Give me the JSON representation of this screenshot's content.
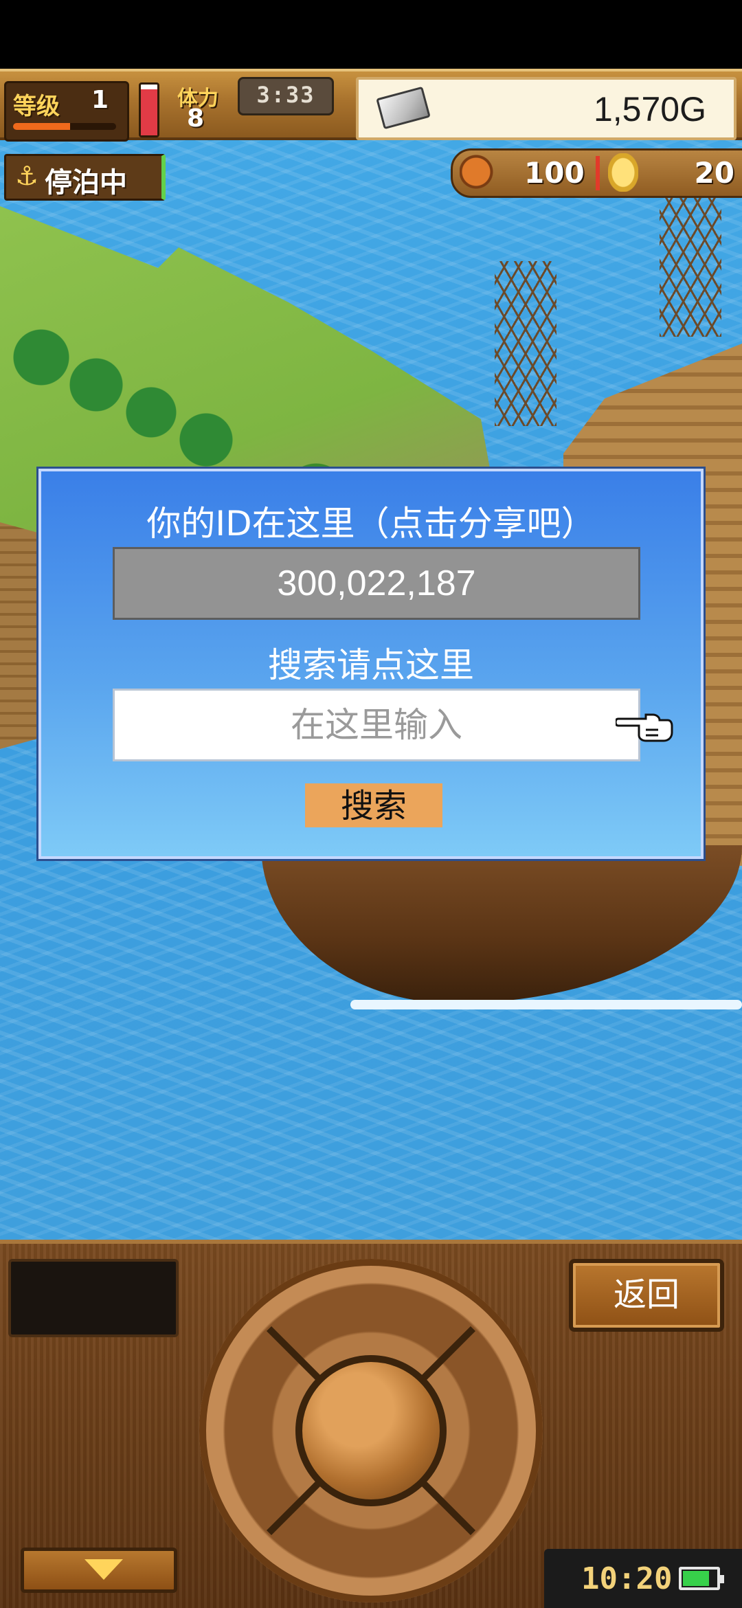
{
  "hud": {
    "level_label": "等级",
    "level_value": "1",
    "level_progress": 0.55,
    "stamina_label": "体力",
    "stamina_value": "8",
    "stamina_fill": 0.9,
    "timer": "3:33",
    "gold": "1,570G",
    "status_badge": "停泊中",
    "food": "100",
    "coins": "20"
  },
  "dialog": {
    "title": "你的ID在这里（点击分享吧）",
    "player_id": "300,022,187",
    "search_hint": "搜索请点这里",
    "search_placeholder": "在这里输入",
    "search_value": "",
    "search_button": "搜索"
  },
  "panel": {
    "back_button": "返回",
    "clock": "10:20",
    "battery_level": 0.8
  },
  "colors": {
    "dialog_top": "#3a7fe8",
    "dialog_bottom": "#7ecaf7",
    "search_button": "#eba55b",
    "id_box": "#939393",
    "ocean": "#3d9fde",
    "wood": "#7a4a20"
  },
  "icons": {
    "anchor": "anchor-icon",
    "gold": "silver-bar-icon",
    "food": "food-icon",
    "coin": "coin-icon",
    "cursor": "pointing-hand-icon",
    "down": "down-arrow-icon",
    "battery": "battery-icon"
  }
}
